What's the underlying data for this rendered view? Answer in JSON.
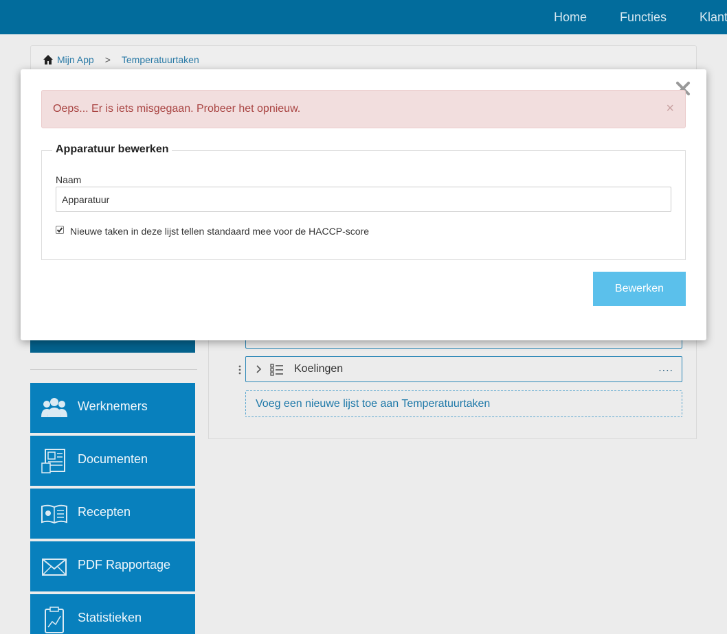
{
  "nav": {
    "home": "Home",
    "functies": "Functies",
    "klant": "Klant"
  },
  "breadcrumb": {
    "root": "Mijn App",
    "separator": ">",
    "current": "Temperatuurtaken"
  },
  "lists": {
    "row2_label": "Koelingen",
    "row_menu": "....",
    "add_list": "Voeg een nieuwe lijst toe aan Temperatuurtaken"
  },
  "sidebar": {
    "items": [
      {
        "label": "Werknemers",
        "icon": "users-icon"
      },
      {
        "label": "Documenten",
        "icon": "documents-icon"
      },
      {
        "label": "Recepten",
        "icon": "recipe-book-icon"
      },
      {
        "label": "PDF Rapportage",
        "icon": "envelope-icon"
      },
      {
        "label": "Statistieken",
        "icon": "clipboard-chart-icon"
      }
    ]
  },
  "modal": {
    "alert": "Oeps... Er is iets misgegaan. Probeer het opnieuw.",
    "alert_close": "×",
    "legend": "Apparatuur bewerken",
    "name_label": "Naam",
    "name_value": "Apparatuur",
    "checkbox_label": "Nieuwe taken in deze lijst tellen standaard mee voor de HACCP-score",
    "checkbox_checked": true,
    "submit": "Bewerken"
  },
  "colors": {
    "topbar": "#026c9c",
    "sidebar": "#0880bd",
    "alert_bg": "#f2dede",
    "alert_text": "#a94442",
    "button": "#5bc0eb"
  }
}
